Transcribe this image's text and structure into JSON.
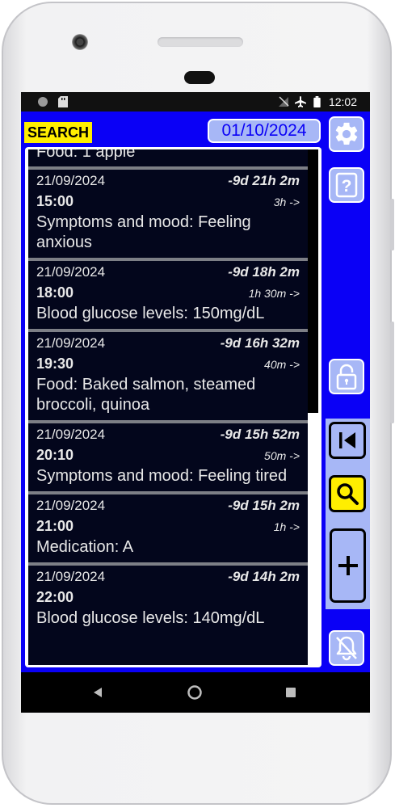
{
  "status_bar": {
    "time": "12:02"
  },
  "header": {
    "search_label": "SEARCH",
    "date": "01/10/2024"
  },
  "partial_entry": {
    "text": "Food: 1 apple"
  },
  "entries": [
    {
      "date": "21/09/2024",
      "delta": "-9d 21h 2m",
      "time": "15:00",
      "duration": "3h ->",
      "text": "Symptoms and mood: Feeling anxious"
    },
    {
      "date": "21/09/2024",
      "delta": "-9d 18h 2m",
      "time": "18:00",
      "duration": "1h 30m ->",
      "text": "Blood glucose levels: 150mg/dL"
    },
    {
      "date": "21/09/2024",
      "delta": "-9d 16h 32m",
      "time": "19:30",
      "duration": "40m ->",
      "text": "Food: Baked salmon, steamed broccoli, quinoa"
    },
    {
      "date": "21/09/2024",
      "delta": "-9d 15h 52m",
      "time": "20:10",
      "duration": "50m ->",
      "text": "Symptoms and mood: Feeling tired"
    },
    {
      "date": "21/09/2024",
      "delta": "-9d 15h 2m",
      "time": "21:00",
      "duration": "1h ->",
      "text": "Medication: A"
    },
    {
      "date": "21/09/2024",
      "delta": "-9d 14h 2m",
      "time": "22:00",
      "duration": "",
      "text": "Blood glucose levels: 140mg/dL"
    }
  ],
  "icons": {
    "settings": "gear-icon",
    "help": "question-icon",
    "lock": "unlock-icon",
    "first": "skip-to-start-icon",
    "search": "magnifier-icon",
    "add": "plus-icon",
    "notifications": "bell-off-icon"
  },
  "colors": {
    "background": "#0a00f6",
    "button_fill": "#a7b7f6",
    "highlight": "#ffee00",
    "list_background": "#03061c"
  }
}
